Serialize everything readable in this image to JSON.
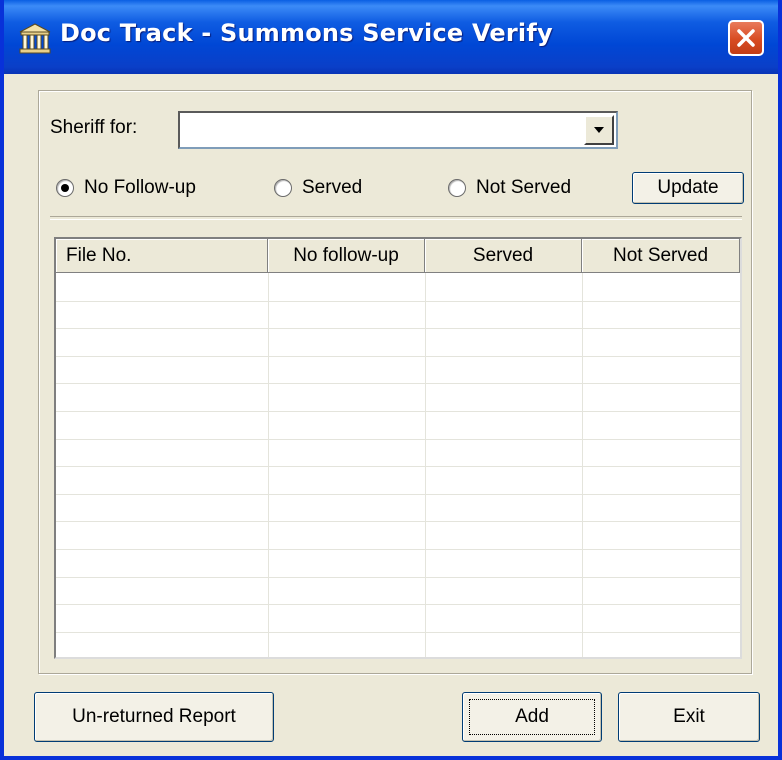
{
  "window": {
    "title": "Doc Track - Summons Service Verify",
    "icon": "building-icon",
    "close_icon": "close-icon"
  },
  "filter": {
    "sheriff_label": "Sheriff for:",
    "sheriff_value": ""
  },
  "radios": [
    {
      "label": "No Follow-up",
      "checked": true
    },
    {
      "label": "Served",
      "checked": false
    },
    {
      "label": "Not Served",
      "checked": false
    }
  ],
  "buttons": {
    "update": "Update",
    "unreturned": "Un-returned Report",
    "add": "Add",
    "exit": "Exit"
  },
  "table": {
    "columns": [
      "File No.",
      "No follow-up",
      "Served",
      "Not Served"
    ],
    "rows": []
  },
  "colors": {
    "titlebar": "#0a5fe3",
    "dialog_bg": "#ece9d8",
    "close_button": "#d84b22"
  }
}
